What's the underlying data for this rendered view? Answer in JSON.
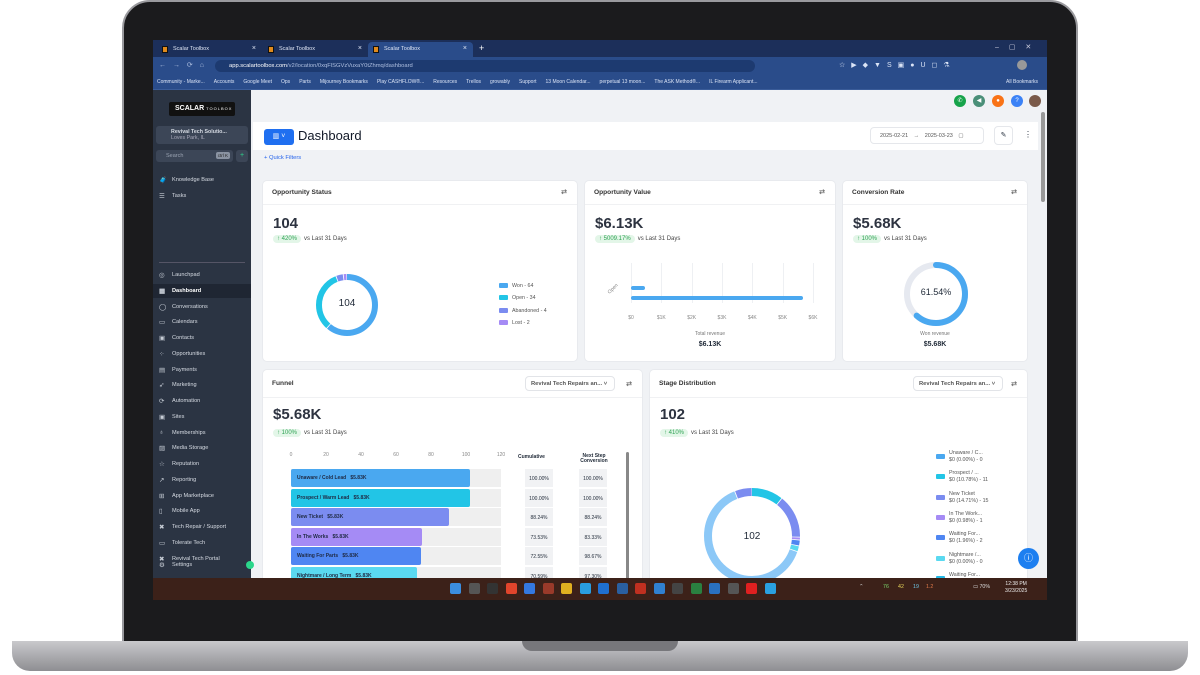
{
  "browser": {
    "tabs": [
      "Scalar Toolbox",
      "Scalar Toolbox",
      "Scalar Toolbox"
    ],
    "url_host": "app.scalartoolbox.com",
    "url_path": "/v2/location/0xqFlSGVzVuxaY0tZhmq/dashboard",
    "bookmarks": [
      "Community - Marke...",
      "Accounts",
      "Google Meet",
      "Ops",
      "Parts",
      "Mijourney Bookmarks",
      "Play CASHFLOW®...",
      "Resources",
      "Trellos",
      "growably",
      "Support",
      "13 Moon Calendar...",
      "perpetual 13 moon...",
      "The ASK Method®...",
      "IL Firearm Applicant...",
      "All Bookmarks"
    ]
  },
  "sidebar": {
    "logo": "SCALAR",
    "logo_sub": "TOOLBOX",
    "account_name": "Revival Tech Solutio...",
    "account_location": "Loves Park, IL",
    "search_placeholder": "Search",
    "search_shortcut": "ctrl K",
    "items": [
      {
        "label": "Knowledge Base",
        "icon": "🧳"
      },
      {
        "label": "Tasks",
        "icon": "☰"
      },
      {
        "label": "Launchpad",
        "icon": "◎"
      },
      {
        "label": "Dashboard",
        "icon": "▦"
      },
      {
        "label": "Conversations",
        "icon": "◯"
      },
      {
        "label": "Calendars",
        "icon": "▭"
      },
      {
        "label": "Contacts",
        "icon": "▣"
      },
      {
        "label": "Opportunities",
        "icon": "⁘"
      },
      {
        "label": "Payments",
        "icon": "▤"
      },
      {
        "label": "Marketing",
        "icon": "➶"
      },
      {
        "label": "Automation",
        "icon": "⟳"
      },
      {
        "label": "Sites",
        "icon": "▣"
      },
      {
        "label": "Memberships",
        "icon": "♁"
      },
      {
        "label": "Media Storage",
        "icon": "▨"
      },
      {
        "label": "Reputation",
        "icon": "☆"
      },
      {
        "label": "Reporting",
        "icon": "↗"
      },
      {
        "label": "App Marketplace",
        "icon": "⊞"
      },
      {
        "label": "Mobile App",
        "icon": "▯"
      },
      {
        "label": "Tech Repair / Support",
        "icon": "✖"
      },
      {
        "label": "Tolerate Tech",
        "icon": "▭"
      },
      {
        "label": "Revival Tech Portal",
        "icon": "✖"
      }
    ],
    "settings": "Settings"
  },
  "header": {
    "title": "Dashboard",
    "date_from": "2025-02-21",
    "date_to": "2025-03-23",
    "quick_filters": "+ Quick Filters"
  },
  "opportunity_status": {
    "title": "Opportunity Status",
    "value": "104",
    "delta": "↑ 420%",
    "compare": "vs Last 31 Days",
    "center": "104",
    "segments": [
      {
        "label": "Won - 64",
        "value": 64,
        "color": "#4aa8f0"
      },
      {
        "label": "Open - 34",
        "value": 34,
        "color": "#22c5e6"
      },
      {
        "label": "Abandoned - 4",
        "value": 4,
        "color": "#7b8cf0"
      },
      {
        "label": "Lost - 2",
        "value": 2,
        "color": "#a58bf5"
      }
    ]
  },
  "opportunity_value": {
    "title": "Opportunity Value",
    "value": "$6.13K",
    "delta": "↑ 5009.17%",
    "compare": "vs Last 31 Days",
    "y_label": "Open",
    "ticks": [
      "$0",
      "$1K",
      "$2K",
      "$3K",
      "$4K",
      "$5K",
      "$6K"
    ],
    "bars_k": [
      0.45,
      5.68
    ],
    "max_k": 6,
    "footer_label": "Total revenue",
    "footer_value": "$6.13K"
  },
  "conversion_rate": {
    "title": "Conversion Rate",
    "value": "$5.68K",
    "delta": "↑ 100%",
    "compare": "vs Last 31 Days",
    "percent_text": "61.54%",
    "percent": 61.54,
    "footer_label": "Won revenue",
    "footer_value": "$5.68K"
  },
  "funnel": {
    "title": "Funnel",
    "pipeline": "Revival Tech Repairs an...",
    "value": "$5.68K",
    "delta": "↑ 100%",
    "compare": "vs Last 31 Days",
    "ticks": [
      "0",
      "20",
      "40",
      "60",
      "80",
      "100",
      "120"
    ],
    "col_cumulative": "Cumulative",
    "col_next": "Next Step Conversion",
    "rows": [
      {
        "label": "Unaware / Cold Lead",
        "amount": "$5.83K",
        "value": 102,
        "color": "#4aa8f0",
        "cumulative": "100.00%",
        "next": "100.00%"
      },
      {
        "label": "Prospect / Warm Lead",
        "amount": "$5.83K",
        "value": 102,
        "color": "#22c5e6",
        "cumulative": "100.00%",
        "next": "100.00%"
      },
      {
        "label": "New Ticket",
        "amount": "$5.83K",
        "value": 90,
        "color": "#7b8cf0",
        "cumulative": "88.24%",
        "next": "88.24%"
      },
      {
        "label": "In The Works",
        "amount": "$5.83K",
        "value": 75,
        "color": "#a58bf5",
        "cumulative": "73.53%",
        "next": "83.33%"
      },
      {
        "label": "Waiting For Parts",
        "amount": "$5.83K",
        "value": 74,
        "color": "#4f86f2",
        "cumulative": "72.55%",
        "next": "98.67%"
      },
      {
        "label": "Nightmare / Long Term",
        "amount": "$5.83K",
        "value": 72,
        "color": "#5ad9f0",
        "cumulative": "70.59%",
        "next": "97.30%"
      }
    ]
  },
  "stage_distribution": {
    "title": "Stage Distribution",
    "pipeline": "Revival Tech Repairs an...",
    "value": "102",
    "delta": "↑ 410%",
    "compare": "vs Last 31 Days",
    "center": "102",
    "legend": [
      {
        "name": "Unaware / C...",
        "detail": "$0 (0.00%) - 0",
        "color": "#4aa8f0"
      },
      {
        "name": "Prospect / ...",
        "detail": "$0 (10.78%) - 11",
        "color": "#22c5e6"
      },
      {
        "name": "New Ticket",
        "detail": "$0 (14.71%) - 15",
        "color": "#7b8cf0"
      },
      {
        "name": "In The Work...",
        "detail": "$0 (0.98%) - 1",
        "color": "#a58bf5"
      },
      {
        "name": "Waiting For...",
        "detail": "$0 (1.96%) - 2",
        "color": "#4f86f2"
      },
      {
        "name": "Nightmare /...",
        "detail": "$0 (0.00%) - 0",
        "color": "#5ad9f0"
      },
      {
        "name": "Waiting For...",
        "detail": "",
        "color": "#22b8e6"
      }
    ],
    "segments": [
      {
        "value": 11,
        "color": "#22c5e6"
      },
      {
        "value": 15,
        "color": "#7b8cf0"
      },
      {
        "value": 1,
        "color": "#a58bf5"
      },
      {
        "value": 2,
        "color": "#4f86f2"
      },
      {
        "value": 2,
        "color": "#5ad9f0"
      },
      {
        "value": 65,
        "color": "#8cc8f7"
      },
      {
        "value": 6,
        "color": "#7b8cf0"
      }
    ]
  },
  "taskbar": {
    "tray_numbers": [
      "76",
      "42",
      "19",
      "1.2"
    ],
    "battery": "70%",
    "time": "12:38 PM",
    "date": "3/23/2025"
  }
}
